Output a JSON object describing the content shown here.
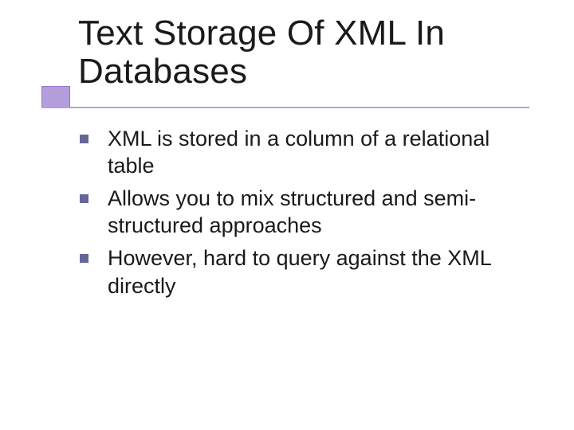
{
  "slide": {
    "title": "Text Storage Of XML In Databases",
    "bullets": [
      "XML is stored in a column of a relational table",
      "Allows you to mix structured and semi-structured approaches",
      "However, hard to query against the XML directly"
    ]
  }
}
